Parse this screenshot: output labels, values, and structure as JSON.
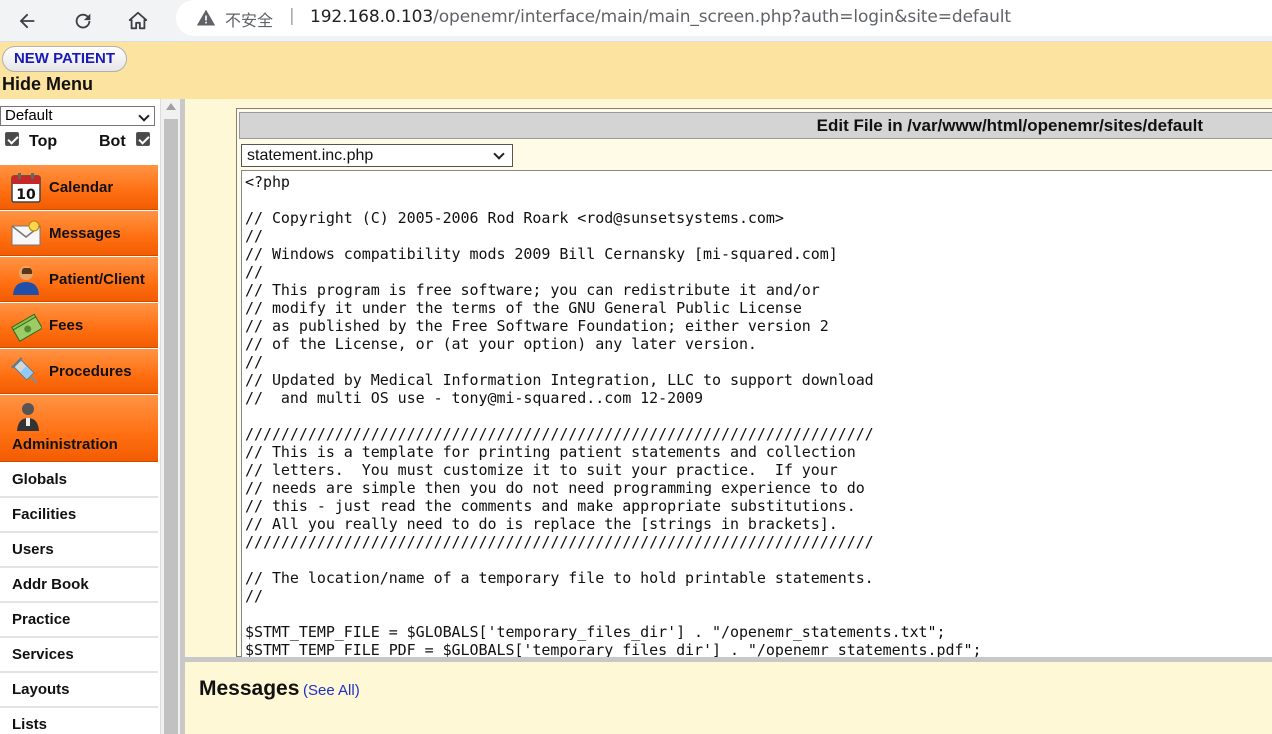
{
  "browser": {
    "insecure_label": "不安全",
    "separator": "|",
    "url_host": "192.168.0.103",
    "url_path": "/openemr/interface/main/main_screen.php?auth=login&site=default"
  },
  "topbar": {
    "new_patient": "NEW PATIENT",
    "hide_menu": "Hide Menu"
  },
  "sidebar": {
    "layout_select": "Default",
    "top_label": "Top",
    "bot_label": "Bot",
    "menu": [
      {
        "label": "Calendar",
        "icon": "calendar-icon"
      },
      {
        "label": "Messages",
        "icon": "envelope-icon"
      },
      {
        "label": "Patient/Client",
        "icon": "person-icon"
      },
      {
        "label": "Fees",
        "icon": "money-icon"
      },
      {
        "label": "Procedures",
        "icon": "syringe-icon"
      },
      {
        "label": "Administration",
        "icon": "admin-icon"
      }
    ],
    "admin_items": [
      "Globals",
      "Facilities",
      "Users",
      "Addr Book",
      "Practice",
      "Services",
      "Layouts",
      "Lists"
    ]
  },
  "editor": {
    "title": "Edit File in /var/www/html/openemr/sites/default",
    "file_select": "statement.inc.php",
    "code": "<?php\n\n// Copyright (C) 2005-2006 Rod Roark <rod@sunsetsystems.com>\n//\n// Windows compatibility mods 2009 Bill Cernansky [mi-squared.com]\n//\n// This program is free software; you can redistribute it and/or\n// modify it under the terms of the GNU General Public License\n// as published by the Free Software Foundation; either version 2\n// of the License, or (at your option) any later version.\n//\n// Updated by Medical Information Integration, LLC to support download\n//  and multi OS use - tony@mi-squared..com 12-2009\n\n//////////////////////////////////////////////////////////////////////\n// This is a template for printing patient statements and collection\n// letters.  You must customize it to suit your practice.  If your\n// needs are simple then you do not need programming experience to do\n// this - just read the comments and make appropriate substitutions.\n// All you really need to do is replace the [strings in brackets].\n//////////////////////////////////////////////////////////////////////\n\n// The location/name of a temporary file to hold printable statements.\n//\n\n$STMT_TEMP_FILE = $GLOBALS['temporary_files_dir'] . \"/openemr_statements.txt\";\n$STMT_TEMP_FILE_PDF = $GLOBALS['temporary_files_dir'] . \"/openemr_statements.pdf\";"
  },
  "messages": {
    "title": "Messages",
    "see_all": "(See All)"
  },
  "colors": {
    "topbar_bg": "#fce3a0",
    "menu_orange": "#ff7a1e",
    "content_bg": "#fff8d6",
    "link_blue": "#1c30c8"
  }
}
